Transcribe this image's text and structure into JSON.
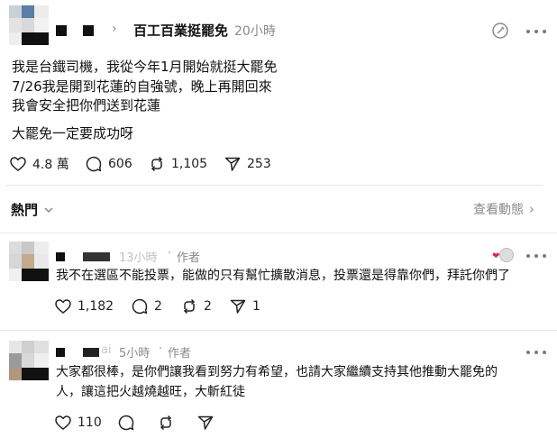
{
  "post": {
    "username": "百工百業挺罷免",
    "time": "20小時",
    "lines": [
      "我是台鐵司機，我從今年1月開始就挺大罷免",
      "7/26我是開到花蓮的自強號，晚上再開回來",
      "我會安全把你們送到花蓮"
    ],
    "line4": "大罷免一定要成功呀",
    "likes": "4.8 萬",
    "comments": "606",
    "reposts": "1,105",
    "shares": "253"
  },
  "replies_header": {
    "label": "熱門",
    "view_activity": "查看動態"
  },
  "replies": [
    {
      "time": "13小時",
      "author_tag": "作者",
      "text": "我不在選區不能投票，能做的只有幫忙擴散消息，投票還是得靠你們，拜託你們了",
      "likes": "1,182",
      "comments": "2",
      "reposts": "2",
      "shares": "1"
    },
    {
      "name_suffix": "ai",
      "time": "5小時",
      "author_tag": "作者",
      "text_line1": "大家都很棒，是你們讓我看到努力有希望，也請大家繼續支持其他推動大罷免的",
      "text_line2": "人，讓這把火越燒越旺，大斬紅徒",
      "likes": "110"
    }
  ],
  "icons": [
    "heart-icon",
    "comment-icon",
    "repost-icon",
    "share-icon",
    "edit-icon",
    "more-icon",
    "chevron-right-icon",
    "chevron-down-icon"
  ]
}
